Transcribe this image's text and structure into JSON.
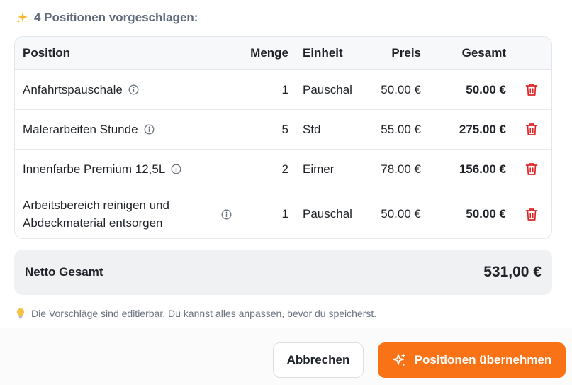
{
  "header": {
    "title": "4 Positionen vorgeschlagen:"
  },
  "table": {
    "columns": {
      "position": "Position",
      "menge": "Menge",
      "einheit": "Einheit",
      "preis": "Preis",
      "gesamt": "Gesamt"
    },
    "rows": [
      {
        "position": "Anfahrtspauschale",
        "menge": "1",
        "einheit": "Pauschal",
        "preis": "50.00 €",
        "gesamt": "50.00 €"
      },
      {
        "position": "Malerarbeiten Stunde",
        "menge": "5",
        "einheit": "Std",
        "preis": "55.00 €",
        "gesamt": "275.00 €"
      },
      {
        "position": "Innenfarbe Premium 12,5L",
        "menge": "2",
        "einheit": "Eimer",
        "preis": "78.00 €",
        "gesamt": "156.00 €"
      },
      {
        "position_line1": "Arbeitsbereich reinigen und",
        "position_line2": "Abdeckmaterial entsorgen",
        "menge": "1",
        "einheit": "Pauschal",
        "preis": "50.00 €",
        "gesamt": "50.00 €"
      }
    ]
  },
  "total": {
    "label": "Netto Gesamt",
    "value": "531,00 €"
  },
  "hint": {
    "text": "Die Vorschläge sind editierbar. Du kannst alles anpassen, bevor du speicherst."
  },
  "buttons": {
    "cancel": "Abbrechen",
    "apply": "Positionen übernehmen"
  },
  "icons": {
    "header": "sparkles-icon",
    "info": "info-icon",
    "delete": "trash-icon",
    "hint": "lightbulb-icon",
    "apply": "sparkles-icon"
  },
  "colors": {
    "accent": "#f97316",
    "delete": "#dc2626",
    "muted_text": "#6b7380"
  }
}
